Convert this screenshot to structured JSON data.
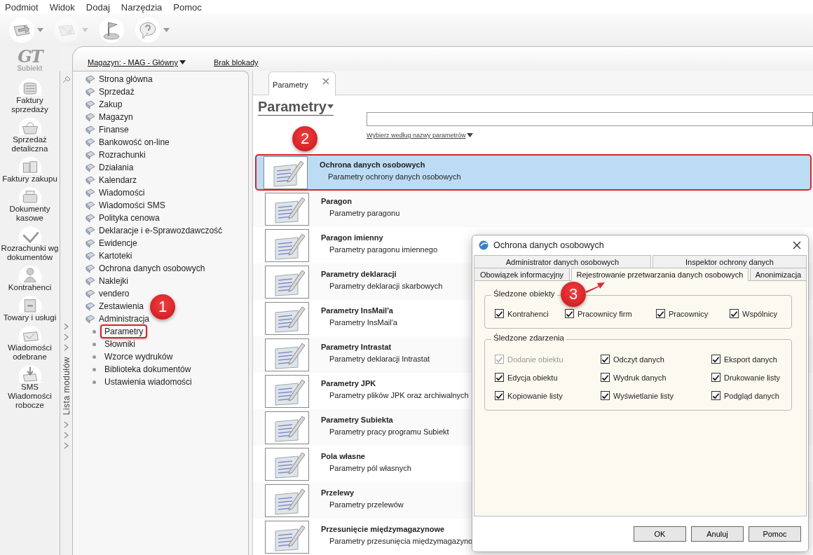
{
  "menu": [
    "Podmiot",
    "Widok",
    "Dodaj",
    "Narzędzia",
    "Pomoc"
  ],
  "toolbar": [
    {
      "disabled": false,
      "menu": true
    },
    {
      "disabled": true,
      "menu": true
    },
    {
      "disabled": false,
      "menu": false
    },
    {
      "disabled": false,
      "menu": true
    }
  ],
  "logo": {
    "mark": "GT",
    "name": "Subiekt"
  },
  "modules": [
    {
      "label": "Faktury sprzedaży"
    },
    {
      "label": "Sprzedaż detaliczna"
    },
    {
      "label": "Faktury zakupu"
    },
    {
      "label": "Dokumenty kasowe"
    },
    {
      "label": "Rozrachunki wg dokumentów"
    },
    {
      "label": "Kontrahenci"
    },
    {
      "label": "Towary i usługi"
    },
    {
      "label": "Wiadomości odebrane"
    },
    {
      "label": "SMS Wiadomości robocze"
    }
  ],
  "header": {
    "warehouse": "Magazyn: - MAG - Główny",
    "lock": "Brak blokady"
  },
  "module_strip": {
    "title": "Lista modułów"
  },
  "tree": [
    {
      "label": "Strona główna"
    },
    {
      "label": "Sprzedaż"
    },
    {
      "label": "Zakup"
    },
    {
      "label": "Magazyn"
    },
    {
      "label": "Finanse"
    },
    {
      "label": "Bankowość on-line"
    },
    {
      "label": "Rozrachunki"
    },
    {
      "label": "Działania"
    },
    {
      "label": "Kalendarz"
    },
    {
      "label": "Wiadomości"
    },
    {
      "label": "Wiadomości SMS"
    },
    {
      "label": "Polityka cenowa"
    },
    {
      "label": "Deklaracje i e-Sprawozdawczość"
    },
    {
      "label": "Ewidencje"
    },
    {
      "label": "Kartoteki"
    },
    {
      "label": "Ochrona danych osobowych"
    },
    {
      "label": "Naklejki"
    },
    {
      "label": "vendero"
    },
    {
      "label": "Zestawienia"
    },
    {
      "label": "Administracja",
      "children": [
        {
          "label": "Parametry",
          "outlined": true
        },
        {
          "label": "Słowniki",
          "outlined": false
        },
        {
          "label": "Wzorce wydruków",
          "outlined": false
        },
        {
          "label": "Biblioteka dokumentów",
          "outlined": false
        },
        {
          "label": "Ustawienia wiadomości",
          "outlined": false
        }
      ]
    }
  ],
  "document_tab": {
    "label": "Parametry"
  },
  "page": {
    "title": "Parametry",
    "filter": "Wybierz według nazwy parametrów"
  },
  "rows": [
    {
      "title": "Ochrona danych osobowych",
      "description": "Parametry ochrony danych osobowych",
      "selected": true,
      "outlined": true
    },
    {
      "title": "Paragon",
      "description": "Parametry paragonu",
      "selected": false,
      "outlined": false
    },
    {
      "title": "Paragon imienny",
      "description": "Parametry paragonu imiennego",
      "selected": false,
      "outlined": false
    },
    {
      "title": "Parametry deklaracji",
      "description": "Parametry deklaracji skarbowych",
      "selected": false,
      "outlined": false
    },
    {
      "title": "Parametry InsMail'a",
      "description": "Parametry InsMail'a",
      "selected": false,
      "outlined": false
    },
    {
      "title": "Parametry Intrastat",
      "description": "Parametry deklaracji Intrastat",
      "selected": false,
      "outlined": false
    },
    {
      "title": "Parametry JPK",
      "description": "Parametry plików JPK oraz archiwalnych",
      "selected": false,
      "outlined": false
    },
    {
      "title": "Parametry Subiekta",
      "description": "Parametry pracy programu Subiekt",
      "selected": false,
      "outlined": false
    },
    {
      "title": "Pola własne",
      "description": "Parametry pól własnych",
      "selected": false,
      "outlined": false
    },
    {
      "title": "Przelewy",
      "description": "Parametry przelewów",
      "selected": false,
      "outlined": false
    },
    {
      "title": "Przesunięcie międzymagazynowe",
      "description": "Parametry przesunięcia międzymagazyno",
      "selected": false,
      "outlined": false
    }
  ],
  "dialog": {
    "title": "Ochrona danych osobowych",
    "tab_rows": [
      {
        "tabs": [
          {
            "label": "Administrator danych osobowych",
            "selected": false
          },
          {
            "label": "Inspektor ochrony danych",
            "selected": false
          }
        ]
      },
      {
        "tabs": [
          {
            "label": "Obowiązek informacyjny",
            "selected": false
          },
          {
            "label": "Rejestrowanie przetwarzania danych osobowych",
            "selected": true
          },
          {
            "label": "Anonimizacja",
            "selected": false
          }
        ]
      }
    ],
    "groups": [
      {
        "title": "Śledzone obiekty",
        "kind": "objects",
        "items": [
          {
            "label": "Kontrahenci",
            "checked": true,
            "disabled": false
          },
          {
            "label": "Pracownicy firm",
            "checked": true,
            "disabled": false
          },
          {
            "label": "Pracownicy",
            "checked": true,
            "disabled": false
          },
          {
            "label": "Wspólnicy",
            "checked": true,
            "disabled": false
          }
        ]
      },
      {
        "title": "Śledzone zdarzenia",
        "kind": "events",
        "items": [
          {
            "label": "Dodanie obiektu",
            "checked": true,
            "disabled": true
          },
          {
            "label": "Odczyt danych",
            "checked": true,
            "disabled": false
          },
          {
            "label": "Eksport danych",
            "checked": true,
            "disabled": false
          },
          {
            "label": "Edycja obiektu",
            "checked": true,
            "disabled": false
          },
          {
            "label": "Wydruk danych",
            "checked": true,
            "disabled": false
          },
          {
            "label": "Drukowanie listy",
            "checked": true,
            "disabled": false
          },
          {
            "label": "Kopiowanie listy",
            "checked": true,
            "disabled": false
          },
          {
            "label": "Wyświetlanie listy",
            "checked": true,
            "disabled": false
          },
          {
            "label": "Podgląd danych",
            "checked": true,
            "disabled": false
          }
        ]
      }
    ],
    "buttons": [
      "OK",
      "Anuluj",
      "Pomoc"
    ]
  },
  "annotations": [
    {
      "label": "1",
      "arrow": false
    },
    {
      "label": "2",
      "arrow": false
    },
    {
      "label": "3",
      "arrow": true
    }
  ]
}
